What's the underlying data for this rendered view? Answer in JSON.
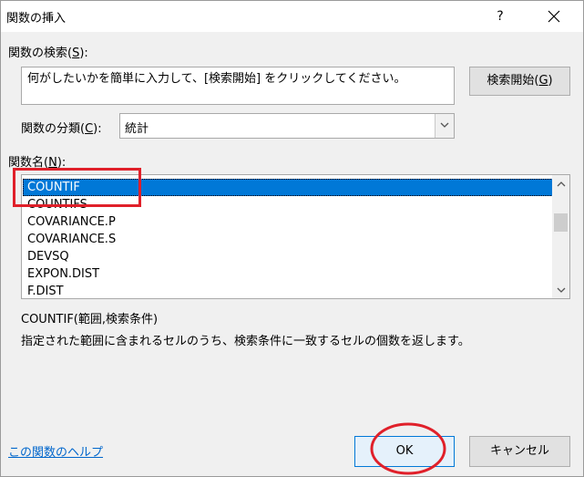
{
  "dialog": {
    "title": "関数の挿入",
    "help_glyph": "?",
    "search_label_pre": "関数の検索(",
    "search_label_key": "S",
    "search_label_post": "):",
    "search_text": "何がしたいかを簡単に入力して、[検索開始] をクリックしてください。",
    "search_button_pre": "検索開始(",
    "search_button_key": "G",
    "search_button_post": ")",
    "category_label_pre": "関数の分類(",
    "category_label_key": "C",
    "category_label_post": "):",
    "category_value": "統計",
    "list_label_pre": "関数名(",
    "list_label_key": "N",
    "list_label_post": "):",
    "functions": [
      "COUNTIF",
      "COUNTIFS",
      "COVARIANCE.P",
      "COVARIANCE.S",
      "DEVSQ",
      "EXPON.DIST",
      "F.DIST"
    ],
    "selected_index": 0,
    "syntax": "COUNTIF(範囲,検索条件)",
    "description": "指定された範囲に含まれるセルのうち、検索条件に一致するセルの個数を返します。",
    "help_link": "この関数のヘルプ",
    "ok_label": "OK",
    "cancel_label": "キャンセル"
  },
  "colors": {
    "selection": "#0078d7",
    "annotation": "#e0202a",
    "link": "#0066cc"
  }
}
